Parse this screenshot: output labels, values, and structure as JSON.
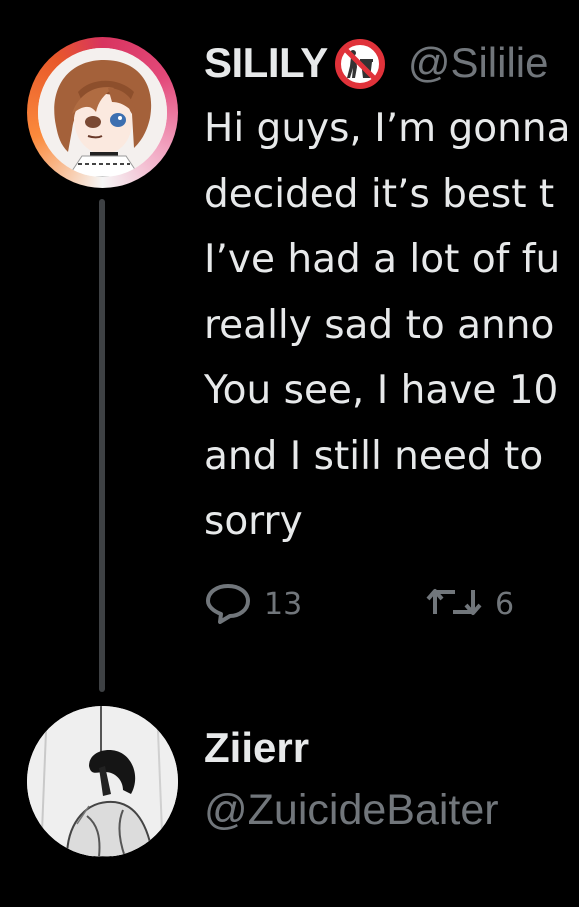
{
  "tweet": {
    "display_name": "SILILY",
    "badge_icon": "no-littering-icon",
    "handle": "@Sililie",
    "body_lines": [
      "Hi guys, I’m gonna",
      "decided it’s best t",
      "I’ve had a lot of fu",
      "really sad to anno",
      "You see, I have 10",
      "and I still need to",
      "sorry"
    ],
    "reply_count": "13",
    "retweet_count": "6"
  },
  "reply": {
    "display_name": "Ziierr",
    "handle": "@ZuicideBaiter"
  },
  "colors": {
    "background": "#000000",
    "text": "#e7e9ea",
    "secondary": "#71767b",
    "thread_line": "#3e4144"
  }
}
